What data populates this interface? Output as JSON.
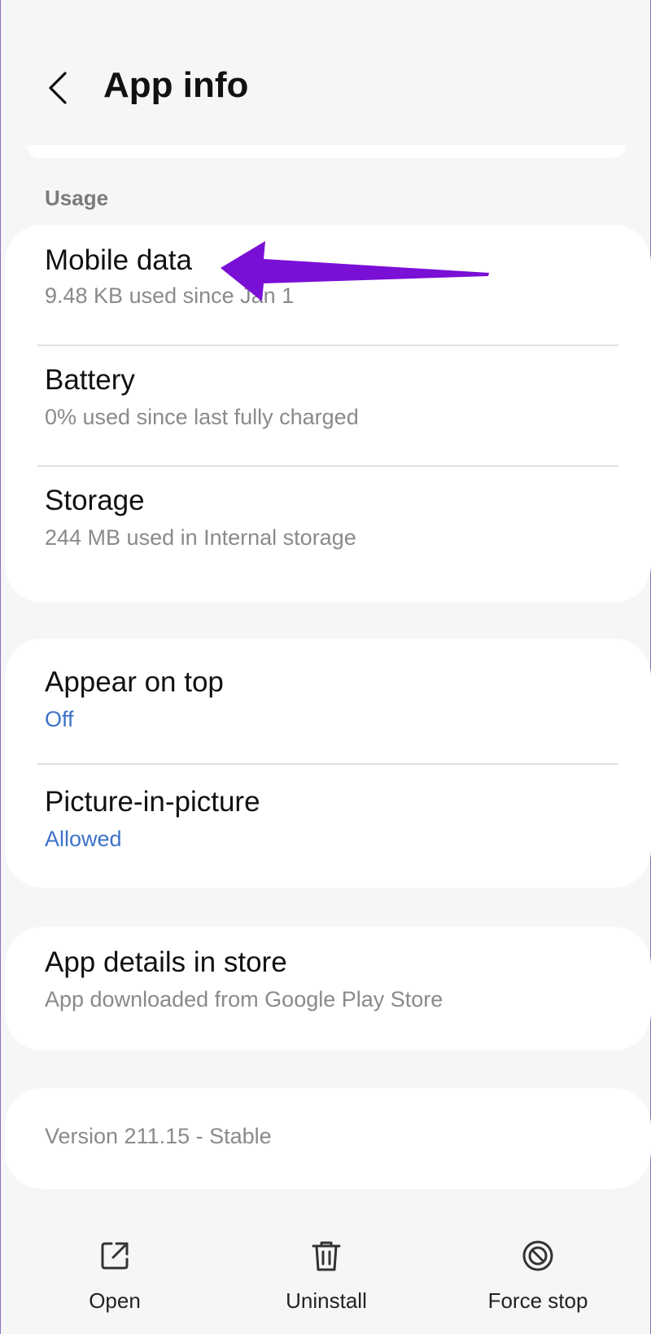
{
  "header": {
    "title": "App info",
    "back_icon": "chevron-left-icon"
  },
  "usage": {
    "section_label": "Usage",
    "items": [
      {
        "title": "Mobile data",
        "subtitle": "9.48 KB used since Jan 1"
      },
      {
        "title": "Battery",
        "subtitle": "0% used since last fully charged"
      },
      {
        "title": "Storage",
        "subtitle": "244 MB used in Internal storage"
      }
    ]
  },
  "permissions": {
    "items": [
      {
        "title": "Appear on top",
        "value": "Off"
      },
      {
        "title": "Picture-in-picture",
        "value": "Allowed"
      }
    ]
  },
  "store": {
    "title": "App details in store",
    "subtitle": "App downloaded from Google Play Store"
  },
  "version": {
    "text": "Version 211.15 - Stable"
  },
  "bottom_bar": {
    "actions": [
      {
        "label": "Open",
        "icon": "open-external-icon"
      },
      {
        "label": "Uninstall",
        "icon": "trash-icon"
      },
      {
        "label": "Force stop",
        "icon": "block-icon"
      }
    ]
  },
  "colors": {
    "background": "#f6f6f6",
    "card": "#ffffff",
    "accent_blue": "#3d72c9",
    "annotation_arrow": "#7a0fd6"
  }
}
